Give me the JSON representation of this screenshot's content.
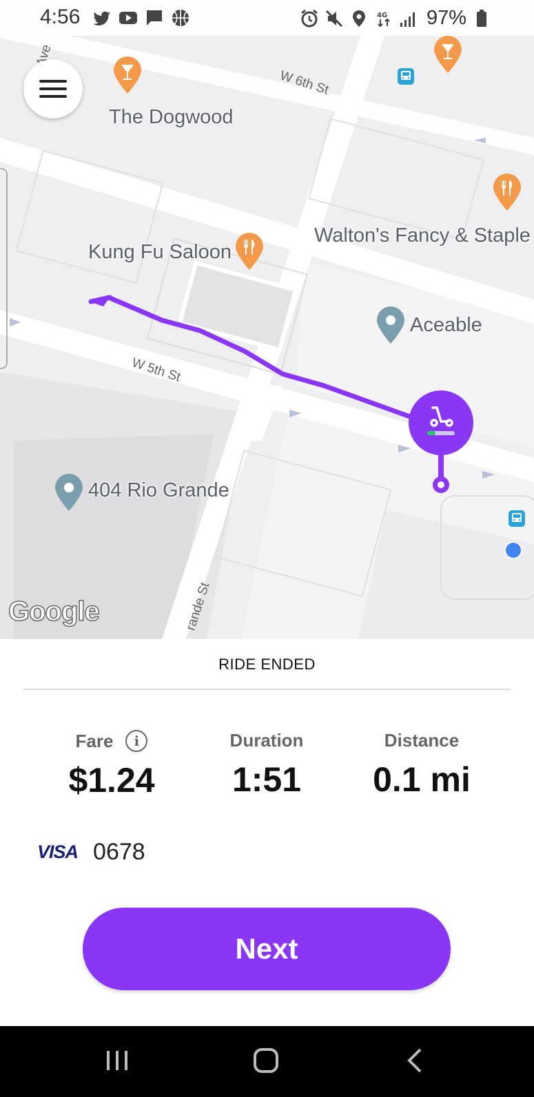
{
  "status_bar": {
    "time": "4:56",
    "battery": "97%",
    "left_icons": [
      "twitter-icon",
      "youtube-icon",
      "message-icon",
      "basketball-icon"
    ],
    "right_icons": [
      "alarm-icon",
      "mute-icon",
      "location-icon",
      "data-icon",
      "signal-icon",
      "battery-icon"
    ]
  },
  "map": {
    "places": {
      "dogwood": "The Dogwood",
      "kungfu": "Kung Fu Saloon",
      "waltons": "Walton's Fancy & Staple",
      "aceable": "Aceable",
      "rio_grande": "404 Rio Grande"
    },
    "streets": {
      "w6th": "W 6th St",
      "w5th": "W 5th St",
      "rio": "rande St",
      "ave": "Ave"
    },
    "google": "Google",
    "route_color": "#8a36f5"
  },
  "sheet": {
    "title": "RIDE ENDED",
    "fare_label": "Fare",
    "fare_value": "$1.24",
    "duration_label": "Duration",
    "duration_value": "1:51",
    "distance_label": "Distance",
    "distance_value": "0.1 mi",
    "card_brand": "VISA",
    "card_digits": "0678",
    "next_label": "Next",
    "accent_color": "#8a36f5"
  },
  "navbar": {
    "buttons": [
      "recent-apps-icon",
      "home-icon",
      "back-icon"
    ]
  }
}
